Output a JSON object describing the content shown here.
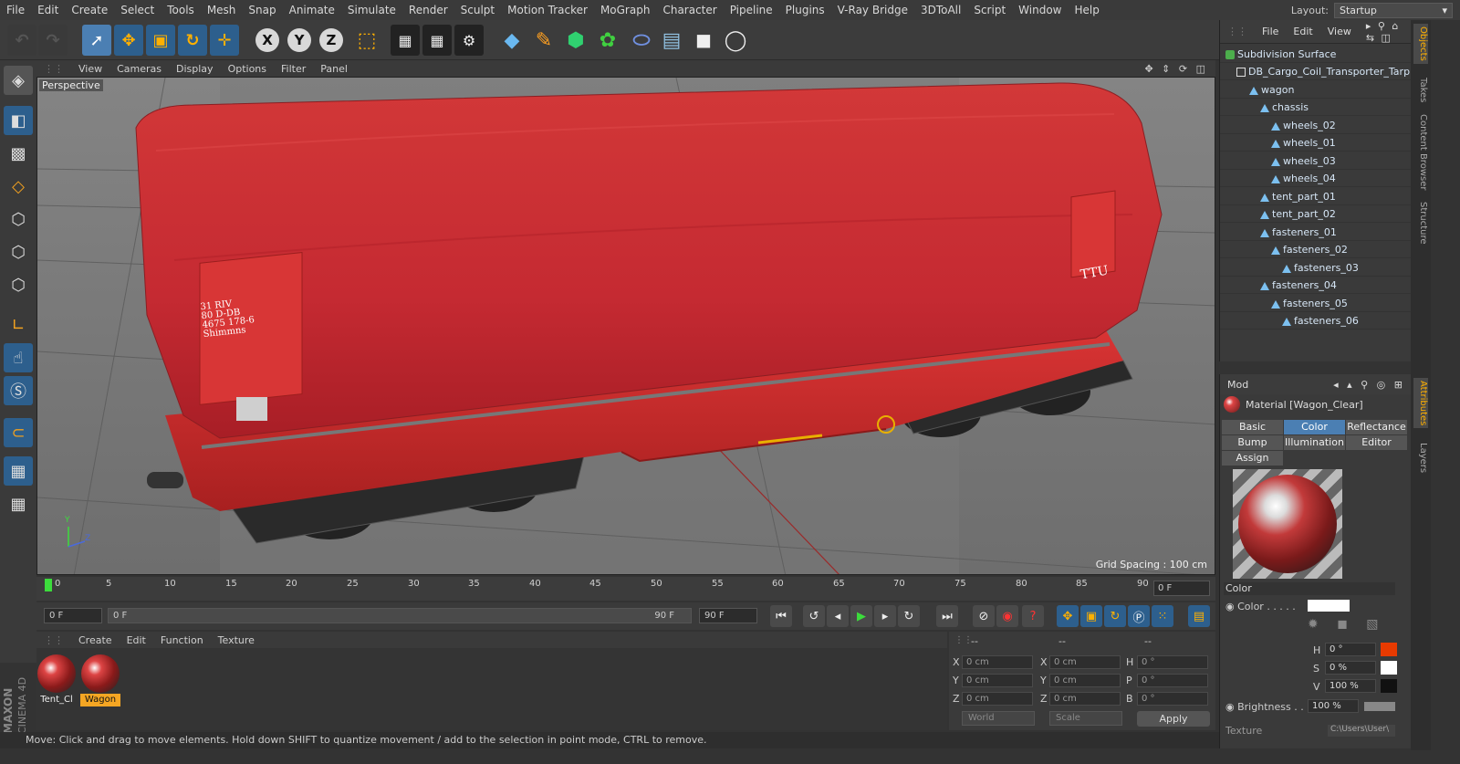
{
  "menu": [
    "File",
    "Edit",
    "Create",
    "Select",
    "Tools",
    "Mesh",
    "Snap",
    "Animate",
    "Simulate",
    "Render",
    "Sculpt",
    "Motion Tracker",
    "MoGraph",
    "Character",
    "Pipeline",
    "Plugins",
    "V-Ray Bridge",
    "3DToAll",
    "Script",
    "Window",
    "Help"
  ],
  "layout": {
    "label": "Layout:",
    "value": "Startup"
  },
  "viewport": {
    "menu": [
      "View",
      "Cameras",
      "Display",
      "Options",
      "Filter",
      "Panel"
    ],
    "label": "Perspective",
    "grid_spacing": "Grid Spacing : 100 cm",
    "tarp_text": {
      "riv": "31 RIV",
      "line2": "80 D-DB",
      "line3": "4675 178-6",
      "line4": "Shimmns",
      "brand": "TTU"
    },
    "axis": {
      "y": "Y",
      "z": "Z"
    }
  },
  "timeline": {
    "ticks": [
      "0",
      "5",
      "10",
      "15",
      "20",
      "25",
      "30",
      "35",
      "40",
      "45",
      "50",
      "55",
      "60",
      "65",
      "70",
      "75",
      "80",
      "85",
      "90"
    ],
    "end_field": "0 F"
  },
  "transport": {
    "start": "0 F",
    "slider_start": "0 F",
    "slider_end": "90 F",
    "end": "90 F"
  },
  "material_manager": {
    "menu": [
      "Create",
      "Edit",
      "Function",
      "Texture"
    ],
    "materials": [
      {
        "name": "Tent_Cl",
        "active": false
      },
      {
        "name": "Wagon",
        "active": true
      }
    ]
  },
  "brand": {
    "maxon": "MAXON",
    "product": "CINEMA 4D"
  },
  "coords": {
    "header": [
      "--",
      "--",
      "--"
    ],
    "rows": [
      {
        "a": "X",
        "av": "0 cm",
        "b": "X",
        "bv": "0 cm",
        "c": "H",
        "cv": "0 °"
      },
      {
        "a": "Y",
        "av": "0 cm",
        "b": "Y",
        "bv": "0 cm",
        "c": "P",
        "cv": "0 °"
      },
      {
        "a": "Z",
        "av": "0 cm",
        "b": "Z",
        "bv": "0 cm",
        "c": "B",
        "cv": "0 °"
      }
    ],
    "mode1": "World",
    "mode2": "Scale",
    "apply": "Apply"
  },
  "status": "Move: Click and drag to move elements. Hold down SHIFT to quantize movement / add to the selection in point mode, CTRL to remove.",
  "objects": {
    "menu": [
      "File",
      "Edit",
      "View"
    ],
    "tree": [
      {
        "name": "Subdivision Surface",
        "depth": 0,
        "icon": "subdivision-icon"
      },
      {
        "name": "DB_Cargo_Coil_Transporter_Tarp",
        "depth": 1,
        "icon": "null-icon"
      },
      {
        "name": "wagon",
        "depth": 2,
        "icon": "polygon-icon"
      },
      {
        "name": "chassis",
        "depth": 3,
        "icon": "polygon-icon"
      },
      {
        "name": "wheels_02",
        "depth": 4,
        "icon": "polygon-icon"
      },
      {
        "name": "wheels_01",
        "depth": 4,
        "icon": "polygon-icon"
      },
      {
        "name": "wheels_03",
        "depth": 4,
        "icon": "polygon-icon"
      },
      {
        "name": "wheels_04",
        "depth": 4,
        "icon": "polygon-icon"
      },
      {
        "name": "tent_part_01",
        "depth": 3,
        "icon": "polygon-icon"
      },
      {
        "name": "tent_part_02",
        "depth": 3,
        "icon": "polygon-icon"
      },
      {
        "name": "fasteners_01",
        "depth": 3,
        "icon": "polygon-icon"
      },
      {
        "name": "fasteners_02",
        "depth": 4,
        "icon": "polygon-icon"
      },
      {
        "name": "fasteners_03",
        "depth": 5,
        "icon": "polygon-icon"
      },
      {
        "name": "fasteners_04",
        "depth": 3,
        "icon": "polygon-icon"
      },
      {
        "name": "fasteners_05",
        "depth": 4,
        "icon": "polygon-icon"
      },
      {
        "name": "fasteners_06",
        "depth": 5,
        "icon": "polygon-icon"
      }
    ]
  },
  "side_tabs": [
    "Objects",
    "Takes",
    "Content Browser",
    "Structure",
    "Attributes",
    "Layers"
  ],
  "attributes": {
    "mode": "Mod",
    "title": "Material [Wagon_Clear]",
    "tabs": [
      "Basic",
      "Color",
      "Reflectance",
      "Bump",
      "Illumination",
      "Editor",
      "Assign"
    ],
    "active_tab": "Color",
    "section": "Color",
    "color_label": "Color . . . . .",
    "hsv": [
      {
        "k": "H",
        "v": "0 °",
        "swatch": "#e83a00"
      },
      {
        "k": "S",
        "v": "0 %",
        "swatch": "#ffffff"
      },
      {
        "k": "V",
        "v": "100 %",
        "swatch": "#111111"
      }
    ],
    "brightness_label": "Brightness . . .",
    "brightness_value": "100 %",
    "texture_label": "Texture",
    "texture_value": "C:\\Users\\User\\"
  },
  "colors": {
    "accent": "#4b7fb3",
    "highlight": "#f5a623",
    "tarp_red": "#c8262e",
    "wagon_red": "#d33030"
  }
}
